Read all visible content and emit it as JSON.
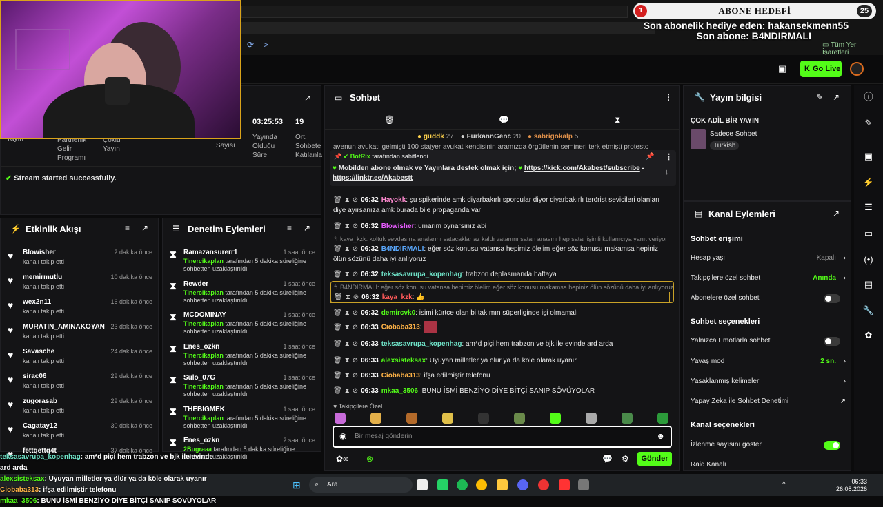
{
  "overlay": {
    "goal_title": "ABONE HEDEFİ",
    "goal_current": "1",
    "goal_target": "25",
    "last_gift": "Son abonelik hediye eden: hakansekmenn55",
    "last_sub": "Son abone: B4NDIRMALI"
  },
  "browser": {
    "bookmarks": "Tüm Yer İşaretleri"
  },
  "nav": {
    "go_live": "Go Live"
  },
  "stats": {
    "items": [
      {
        "value": "",
        "label": "Yayın"
      },
      {
        "value": "",
        "label": "Partnerlik Gelir Programı"
      },
      {
        "value": "",
        "label": "Çoklu Yayın"
      },
      {
        "value": "",
        "label": ""
      },
      {
        "value": "",
        "label": "Sayısı"
      },
      {
        "value": "03:25:53",
        "label": "Yayında Olduğu Süre"
      },
      {
        "value": "19",
        "label": "Ort. Sohbete Katılanla"
      }
    ],
    "status": "Stream started successfully."
  },
  "activity": {
    "title": "Etkinlik Akışı",
    "items": [
      {
        "name": "Blowisher",
        "sub": "kanalı takip etti",
        "time": "2 dakika önce"
      },
      {
        "name": "memirmutlu",
        "sub": "kanalı takip etti",
        "time": "10 dakika önce"
      },
      {
        "name": "wex2n11",
        "sub": "kanalı takip etti",
        "time": "16 dakika önce"
      },
      {
        "name": "MURATIN_AMINAKOYAN",
        "sub": "kanalı takip etti",
        "time": "23 dakika önce"
      },
      {
        "name": "Savasche",
        "sub": "kanalı takip etti",
        "time": "24 dakika önce"
      },
      {
        "name": "sirac06",
        "sub": "kanalı takip etti",
        "time": "29 dakika önce"
      },
      {
        "name": "zugorasab",
        "sub": "kanalı takip etti",
        "time": "29 dakika önce"
      },
      {
        "name": "Cagatay12",
        "sub": "kanalı takip etti",
        "time": "30 dakika önce"
      },
      {
        "name": "fettqettq4t",
        "sub": "",
        "time": "37 dakika önce"
      }
    ]
  },
  "moderation": {
    "title": "Denetim Eylemleri",
    "items": [
      {
        "name": "Ramazansurerr1",
        "mod": "Tinercikaplan",
        "desc": "tarafından 5 dakika süreliğine sohbetten uzaklaştırıldı",
        "time": "1 saat önce"
      },
      {
        "name": "Rewder",
        "mod": "Tinercikaplan",
        "desc": "tarafından 5 dakika süreliğine sohbetten uzaklaştırıldı",
        "time": "1 saat önce"
      },
      {
        "name": "MCDOMINAY",
        "mod": "Tinercikaplan",
        "desc": "tarafından 5 dakika süreliğine sohbetten uzaklaştırıldı",
        "time": "1 saat önce"
      },
      {
        "name": "Enes_ozkn",
        "mod": "Tinercikaplan",
        "desc": "tarafından 5 dakika süreliğine sohbetten uzaklaştırıldı",
        "time": "1 saat önce"
      },
      {
        "name": "Sulo_07G",
        "mod": "Tinercikaplan",
        "desc": "tarafından 5 dakika süreliğine sohbetten uzaklaştırıldı",
        "time": "1 saat önce"
      },
      {
        "name": "THEBIGMEK",
        "mod": "Tinercikaplan",
        "desc": "tarafından 5 dakika süreliğine sohbetten uzaklaştırıldı",
        "time": "1 saat önce"
      },
      {
        "name": "Enes_ozkn",
        "mod": "2Bugraaa",
        "desc": "tarafından 5 dakika süreliğine sohbetten uzaklaştırıldı",
        "time": "2 saat önce"
      }
    ]
  },
  "chat": {
    "title": "Sohbet",
    "leaders": [
      {
        "name": "guddk",
        "count": "27"
      },
      {
        "name": "FurkannGenc",
        "count": "20"
      },
      {
        "name": "sabrigokalp",
        "count": "5"
      }
    ],
    "cut_text": "avenun avukatı gelmişti 100 stajyer avukat kendisinin aramızda örgütlenin semineri terk etmişti protesto",
    "pinned": {
      "by": "BotRix",
      "by_suffix": "tarafından sabitlendi",
      "text": "Mobilden abone olmak ve Yayınlara destek olmak için;",
      "link1": "https://kick.com/Akabest/subscribe",
      "link2": "https://linktr.ee/Akabestt"
    },
    "messages": [
      {
        "time": "06:32",
        "user": "Hayokk",
        "color": "#ff8ad0",
        "text": "şu spikerinde amk diyarbakırlı sporcular diyor diyarbakırlı terörist sevicileri olanları diye ayırsanıza amk burada bile propaganda var"
      },
      {
        "time": "06:32",
        "user": "Blowisher",
        "color": "#e85cff",
        "text": "umarım oynarsınız abi"
      },
      {
        "reply": "kaya_kzk: koltuk sevdasına analarını satacaklar az kaldı vatanını satan anasını hep satar işimli kullanıcıya yanıt veriyor"
      },
      {
        "time": "06:32",
        "user": "B4NDIRMALI",
        "color": "#5aa9ff",
        "text": "eğer söz konusu vatansa hepimiz ölelim eğer söz konusu makamsa hepiniz ölün sözünü daha iyi anlıyoruz"
      },
      {
        "time": "06:32",
        "user": "teksasavrupa_kopenhag",
        "color": "#6fe3c8",
        "text": "trabzon deplasmanda haftaya"
      },
      {
        "reply": "B4NDIRMALI: eğer söz konusu vatansa hepimiz ölelim eğer söz konusu makamsa hepiniz ölün sözünü daha iyi anlıyoruz işi..."
      },
      {
        "time": "06:32",
        "user": "kaya_kzk",
        "color": "#ff5a5a",
        "text": "👍"
      },
      {
        "time": "06:32",
        "user": "demircvk0",
        "color": "#53fc18",
        "text": "isimi kürtce olan bi takımın süperliginde işi olmamalı"
      },
      {
        "time": "06:33",
        "user": "Ciobaba313",
        "color": "#ffb347",
        "text": ""
      },
      {
        "time": "06:33",
        "user": "teksasavrupa_kopenhag",
        "color": "#6fe3c8",
        "text": "am*d piçi hem trabzon ve bjk ile evinde ard arda"
      },
      {
        "time": "06:33",
        "user": "alexsisteksax",
        "color": "#53fc18",
        "text": "Uyuyan milletler ya ölür ya da köle olarak uyanır"
      },
      {
        "time": "06:33",
        "user": "Ciobaba313",
        "color": "#ffb347",
        "text": "ifşa edilmiştir telefonu"
      },
      {
        "time": "06:33",
        "user": "mkaa_3506",
        "color": "#53fc18",
        "text": "BUNU İSMİ BENZİYO DİYE BİTÇİ SANIP SÖVÜYOLAR"
      }
    ],
    "followers_only": "Takipçilere Özel",
    "input_placeholder": "Bir mesaj gönderin",
    "send": "Gönder"
  },
  "stream_info": {
    "title": "Yayın bilgisi",
    "stream_title": "ÇOK ADİL BİR YAYIN",
    "category": "Sadece Sohbet",
    "tag": "Turkish"
  },
  "channel_actions": {
    "title": "Kanal Eylemleri",
    "chat_access": "Sohbet erişimi",
    "account_age": {
      "label": "Hesap yaşı",
      "value": "Kapalı"
    },
    "followers_chat": {
      "label": "Takipçilere özel sohbet",
      "value": "Anında"
    },
    "subs_chat": {
      "label": "Abonelere özel sohbet"
    },
    "chat_options": "Sohbet seçenekleri",
    "emote_only": {
      "label": "Yalnızca Emotlarla sohbet"
    },
    "slow_mode": {
      "label": "Yavaş mod",
      "value": "2 sn."
    },
    "banned_words": {
      "label": "Yasaklanmış kelimeler"
    },
    "ai_moderation": {
      "label": "Yapay Zeka ile Sohbet Denetimi"
    },
    "channel_options": "Kanal seçenekleri",
    "show_viewers": {
      "label": "İzlenme sayısını göster"
    },
    "raid": {
      "label": "Raid Kanalı"
    }
  },
  "overlay_chat": [
    {
      "user": "teksasavrupa_kopenhag",
      "color": "#6fe3c8",
      "text": ": am*d piçi hem trabzon ve bjk ile evinde ard arda"
    },
    {
      "user": "alexsisteksax",
      "color": "#53fc18",
      "text": ": Uyuyan milletler ya ölür ya da köle olarak uyanır"
    },
    {
      "user": "Ciobaba313",
      "color": "#ffb347",
      "text": ": ifşa edilmiştir telefonu"
    },
    {
      "user": "mkaa_3506",
      "color": "#53fc18",
      "text": ": BUNU İSMİ BENZİYO DİYE BİTÇİ SANIP SÖVÜYOLAR"
    }
  ],
  "taskbar": {
    "search": "Ara",
    "time": "06:33",
    "date": "26.08.2026"
  },
  "colors": {
    "accent": "#53fc18",
    "panel": "#141416"
  }
}
